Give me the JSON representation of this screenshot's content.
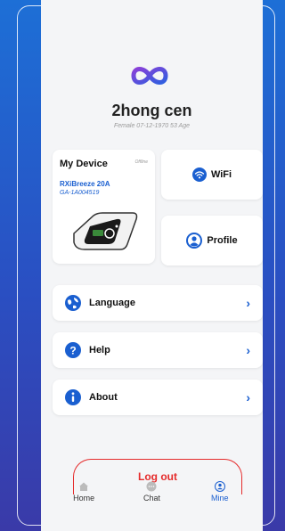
{
  "user": {
    "name": "2hong cen",
    "meta": "Female 07-12-1970 53 Age"
  },
  "device": {
    "title": "My Device",
    "status": "Offline",
    "model": "RXiBreeze 20A",
    "serial": "GA-1A004519"
  },
  "tiles": {
    "wifi": "WiFi",
    "profile": "Profile"
  },
  "menu": [
    {
      "label": "Language",
      "icon": "globe-icon"
    },
    {
      "label": "Help",
      "icon": "question-icon"
    },
    {
      "label": "About",
      "icon": "info-icon"
    }
  ],
  "logout": "Log out",
  "tabs": [
    {
      "label": "Home",
      "icon": "home-icon"
    },
    {
      "label": "Chat",
      "icon": "chat-icon"
    },
    {
      "label": "Mine",
      "icon": "user-icon",
      "active": true
    }
  ],
  "colors": {
    "accent": "#1a5fd0",
    "danger": "#e52b2b",
    "background_gradient": [
      "#1d6fd6",
      "#3a3aa8"
    ]
  }
}
